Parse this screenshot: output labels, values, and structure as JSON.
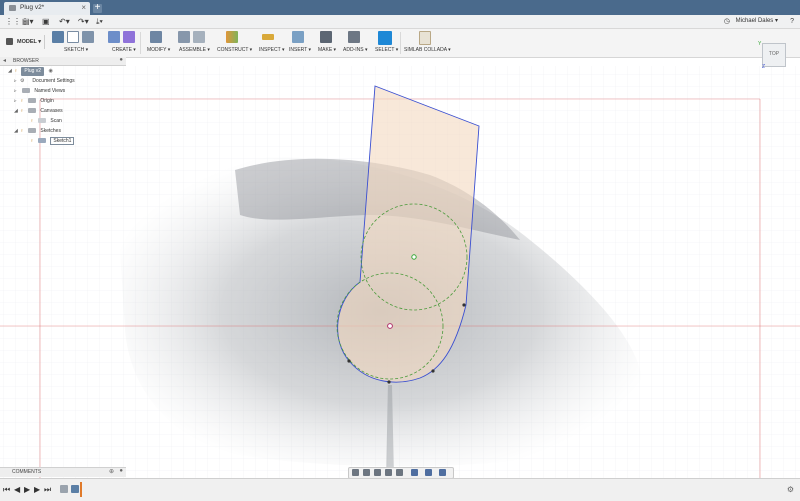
{
  "app": {
    "document_tab": "Plug v2*",
    "new_tab": "+",
    "user": "Michael Dales ▾"
  },
  "quick_access": {
    "grid": "⋮⋮⋮",
    "file": "▤▾",
    "save": "▣",
    "undo": "↶▾",
    "redo": "↷▾",
    "recent": "⤓▾"
  },
  "ribbon": {
    "workspace": "MODEL ▾",
    "groups": [
      {
        "label": "SKETCH ▾"
      },
      {
        "label": "CREATE ▾"
      },
      {
        "label": "MODIFY ▾"
      },
      {
        "label": "ASSEMBLE ▾"
      },
      {
        "label": "CONSTRUCT ▾"
      },
      {
        "label": "INSPECT ▾"
      },
      {
        "label": "INSERT ▾"
      },
      {
        "label": "MAKE ▾"
      },
      {
        "label": "ADD-INS ▾"
      },
      {
        "label": "SELECT ▾"
      },
      {
        "label": "SIMLAB COLLADA ▾"
      }
    ]
  },
  "browser": {
    "title": "BROWSER",
    "root": "Plug v2",
    "items": [
      {
        "label": "Document Settings"
      },
      {
        "label": "Named Views"
      },
      {
        "label": "Origin"
      },
      {
        "label": "Canvases"
      },
      {
        "label": "Scan"
      },
      {
        "label": "Sketches"
      },
      {
        "label": "Sketch1"
      }
    ]
  },
  "viewcube": {
    "face": "TOP",
    "axis_y": "Y",
    "axis_z": "Z"
  },
  "comments": {
    "label": "COMMENTS"
  },
  "timeline": {
    "first": "⏮",
    "prev": "◀",
    "play": "▶",
    "next": "▶",
    "last": "⏭"
  },
  "colors": {
    "titlebar": "#4a6a8c",
    "sketch_fill": "#f3d9bf",
    "sketch_line": "#3a4fd1",
    "construction": "#4a9a3a",
    "axis_red": "#e06060",
    "select_active": "#1e88d6"
  }
}
